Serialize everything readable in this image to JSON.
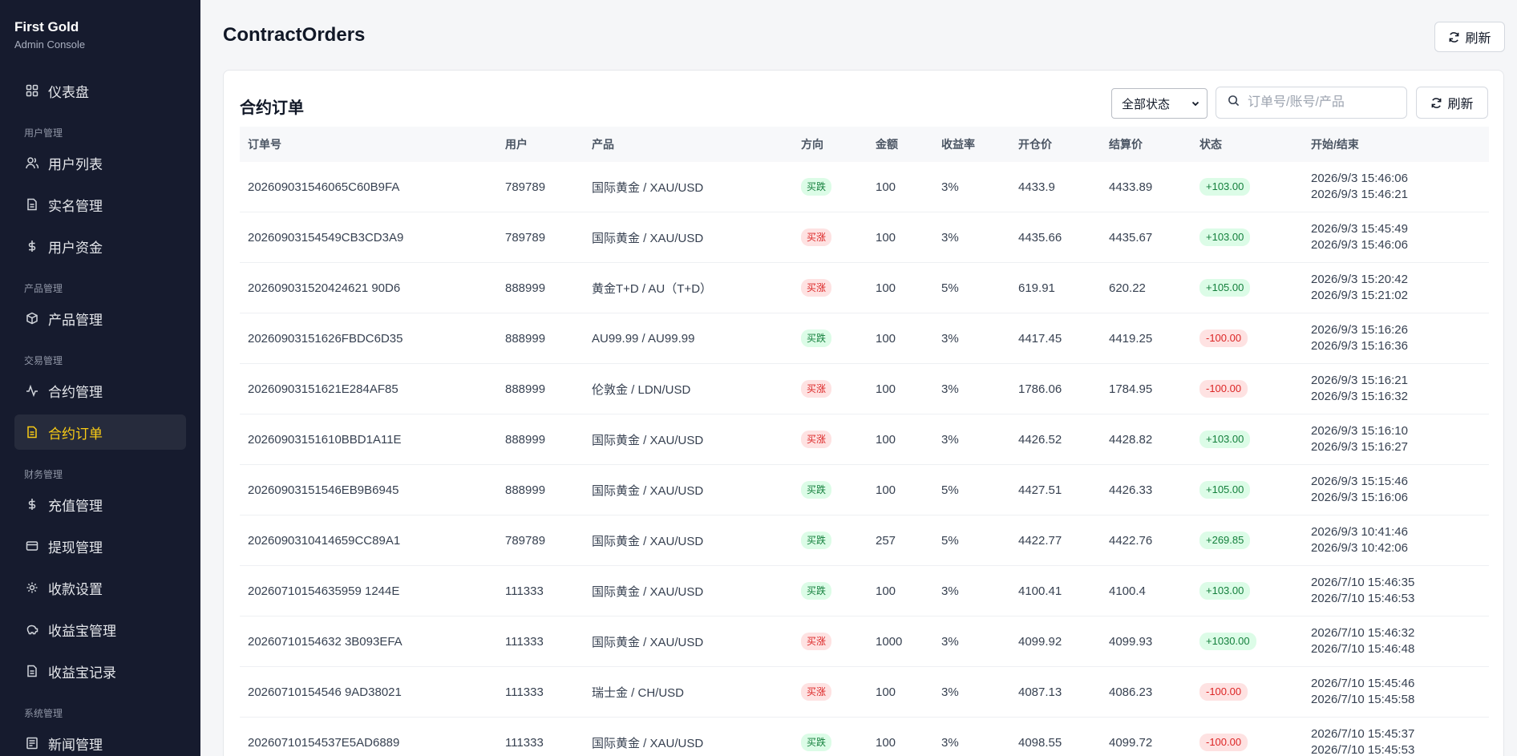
{
  "brand": {
    "title": "First Gold",
    "subtitle": "Admin Console"
  },
  "sidebar": {
    "items": [
      {
        "label": "仪表盘",
        "icon": "dashboard-icon"
      },
      {
        "group": "用户管理"
      },
      {
        "label": "用户列表",
        "icon": "users-icon"
      },
      {
        "label": "实名管理",
        "icon": "document-icon"
      },
      {
        "label": "用户资金",
        "icon": "dollar-icon"
      },
      {
        "group": "产品管理"
      },
      {
        "label": "产品管理",
        "icon": "box-icon"
      },
      {
        "group": "交易管理"
      },
      {
        "label": "合约管理",
        "icon": "activity-icon"
      },
      {
        "label": "合约订单",
        "icon": "document-icon",
        "active": true
      },
      {
        "group": "财务管理"
      },
      {
        "label": "充值管理",
        "icon": "dollar-icon"
      },
      {
        "label": "提现管理",
        "icon": "card-icon"
      },
      {
        "label": "收款设置",
        "icon": "gear-icon"
      },
      {
        "label": "收益宝管理",
        "icon": "piggybank-icon"
      },
      {
        "label": "收益宝记录",
        "icon": "document-icon"
      },
      {
        "group": "系统管理"
      },
      {
        "label": "新闻管理",
        "icon": "newspaper-icon"
      }
    ]
  },
  "header": {
    "title": "ContractOrders",
    "refresh_label": "刷新"
  },
  "card": {
    "title": "合约订单",
    "status_select": "全部状态",
    "search_placeholder": "订单号/账号/产品",
    "refresh_label": "刷新"
  },
  "table": {
    "columns": [
      "订单号",
      "用户",
      "产品",
      "方向",
      "金额",
      "收益率",
      "开仓价",
      "结算价",
      "状态",
      "开始/结束"
    ],
    "rows": [
      {
        "order": "202609031546065C60B9FA",
        "user": "789789",
        "product": "国际黄金 / XAU/USD",
        "dir": "买跌",
        "amount": "100",
        "rate": "3%",
        "open": "4433.9",
        "settle": "4433.89",
        "pl": "+103.00",
        "start": "2026/9/3 15:46:06",
        "end": "2026/9/3 15:46:21"
      },
      {
        "order": "20260903154549CB3CD3A9",
        "user": "789789",
        "product": "国际黄金 / XAU/USD",
        "dir": "买涨",
        "amount": "100",
        "rate": "3%",
        "open": "4435.66",
        "settle": "4435.67",
        "pl": "+103.00",
        "start": "2026/9/3 15:45:49",
        "end": "2026/9/3 15:46:06"
      },
      {
        "order": "202609031520424621 90D6",
        "user": "888999",
        "product": "黄金T+D / AU（T+D）",
        "dir": "买涨",
        "amount": "100",
        "rate": "5%",
        "open": "619.91",
        "settle": "620.22",
        "pl": "+105.00",
        "start": "2026/9/3 15:20:42",
        "end": "2026/9/3 15:21:02"
      },
      {
        "order": "20260903151626FBDC6D35",
        "user": "888999",
        "product": "AU99.99 / AU99.99",
        "dir": "买跌",
        "amount": "100",
        "rate": "3%",
        "open": "4417.45",
        "settle": "4419.25",
        "pl": "-100.00",
        "start": "2026/9/3 15:16:26",
        "end": "2026/9/3 15:16:36"
      },
      {
        "order": "20260903151621E284AF85",
        "user": "888999",
        "product": "伦敦金 / LDN/USD",
        "dir": "买涨",
        "amount": "100",
        "rate": "3%",
        "open": "1786.06",
        "settle": "1784.95",
        "pl": "-100.00",
        "start": "2026/9/3 15:16:21",
        "end": "2026/9/3 15:16:32"
      },
      {
        "order": "20260903151610BBD1A11E",
        "user": "888999",
        "product": "国际黄金 / XAU/USD",
        "dir": "买涨",
        "amount": "100",
        "rate": "3%",
        "open": "4426.52",
        "settle": "4428.82",
        "pl": "+103.00",
        "start": "2026/9/3 15:16:10",
        "end": "2026/9/3 15:16:27"
      },
      {
        "order": "20260903151546EB9B6945",
        "user": "888999",
        "product": "国际黄金 / XAU/USD",
        "dir": "买跌",
        "amount": "100",
        "rate": "5%",
        "open": "4427.51",
        "settle": "4426.33",
        "pl": "+105.00",
        "start": "2026/9/3 15:15:46",
        "end": "2026/9/3 15:16:06"
      },
      {
        "order": "2026090310414659CC89A1",
        "user": "789789",
        "product": "国际黄金 / XAU/USD",
        "dir": "买跌",
        "amount": "257",
        "rate": "5%",
        "open": "4422.77",
        "settle": "4422.76",
        "pl": "+269.85",
        "start": "2026/9/3 10:41:46",
        "end": "2026/9/3 10:42:06"
      },
      {
        "order": "20260710154635959 1244E",
        "user": "111333",
        "product": "国际黄金 / XAU/USD",
        "dir": "买跌",
        "amount": "100",
        "rate": "3%",
        "open": "4100.41",
        "settle": "4100.4",
        "pl": "+103.00",
        "start": "2026/7/10 15:46:35",
        "end": "2026/7/10 15:46:53"
      },
      {
        "order": "20260710154632 3B093EFA",
        "user": "111333",
        "product": "国际黄金 / XAU/USD",
        "dir": "买涨",
        "amount": "1000",
        "rate": "3%",
        "open": "4099.92",
        "settle": "4099.93",
        "pl": "+1030.00",
        "start": "2026/7/10 15:46:32",
        "end": "2026/7/10 15:46:48"
      },
      {
        "order": "20260710154546 9AD38021",
        "user": "111333",
        "product": "瑞士金 / CH/USD",
        "dir": "买涨",
        "amount": "100",
        "rate": "3%",
        "open": "4087.13",
        "settle": "4086.23",
        "pl": "-100.00",
        "start": "2026/7/10 15:45:46",
        "end": "2026/7/10 15:45:58"
      },
      {
        "order": "20260710154537E5AD6889",
        "user": "111333",
        "product": "国际黄金 / XAU/USD",
        "dir": "买跌",
        "amount": "100",
        "rate": "3%",
        "open": "4098.55",
        "settle": "4099.72",
        "pl": "-100.00",
        "start": "2026/7/10 15:45:37",
        "end": "2026/7/10 15:45:53"
      }
    ]
  },
  "colors": {
    "sidebar_bg": "#161b2e",
    "active_accent": "#facc15",
    "buy_up": "#dc2626",
    "buy_down": "#15803d"
  }
}
